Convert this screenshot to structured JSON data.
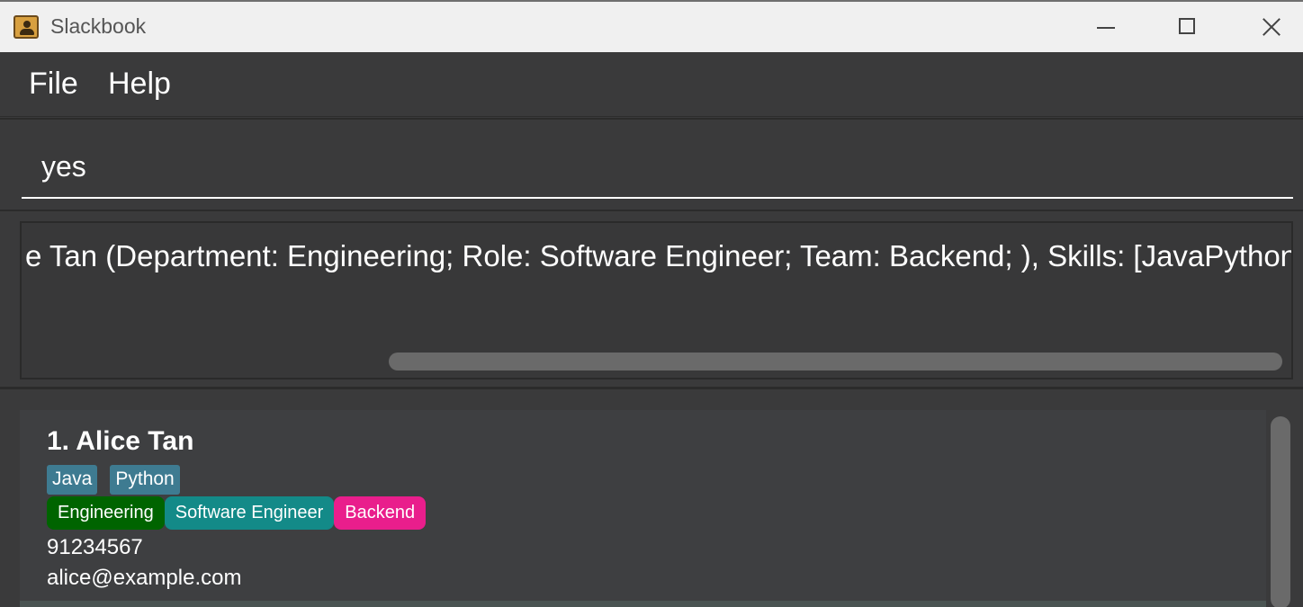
{
  "window": {
    "title": "Slackbook",
    "icon": "address-book-icon"
  },
  "menu": {
    "file_label": "File",
    "help_label": "Help"
  },
  "command_box": {
    "value": "yes"
  },
  "result_display": {
    "text": "e Tan (Department: Engineering; Role: Software Engineer; Team: Backend; ), Skills: [JavaPython]?"
  },
  "person_list": [
    {
      "index_name": "1. Alice Tan",
      "skills": [
        "Java",
        "Python"
      ],
      "department": "Engineering",
      "role": "Software Engineer",
      "team": "Backend",
      "phone": "91234567",
      "email": "alice@example.com"
    }
  ],
  "colors": {
    "background": "#3a3a3b",
    "skill_tag": "#3e7b91",
    "department_tag": "#006400",
    "role_tag": "#138a88",
    "team_tag": "#e91e8c"
  }
}
